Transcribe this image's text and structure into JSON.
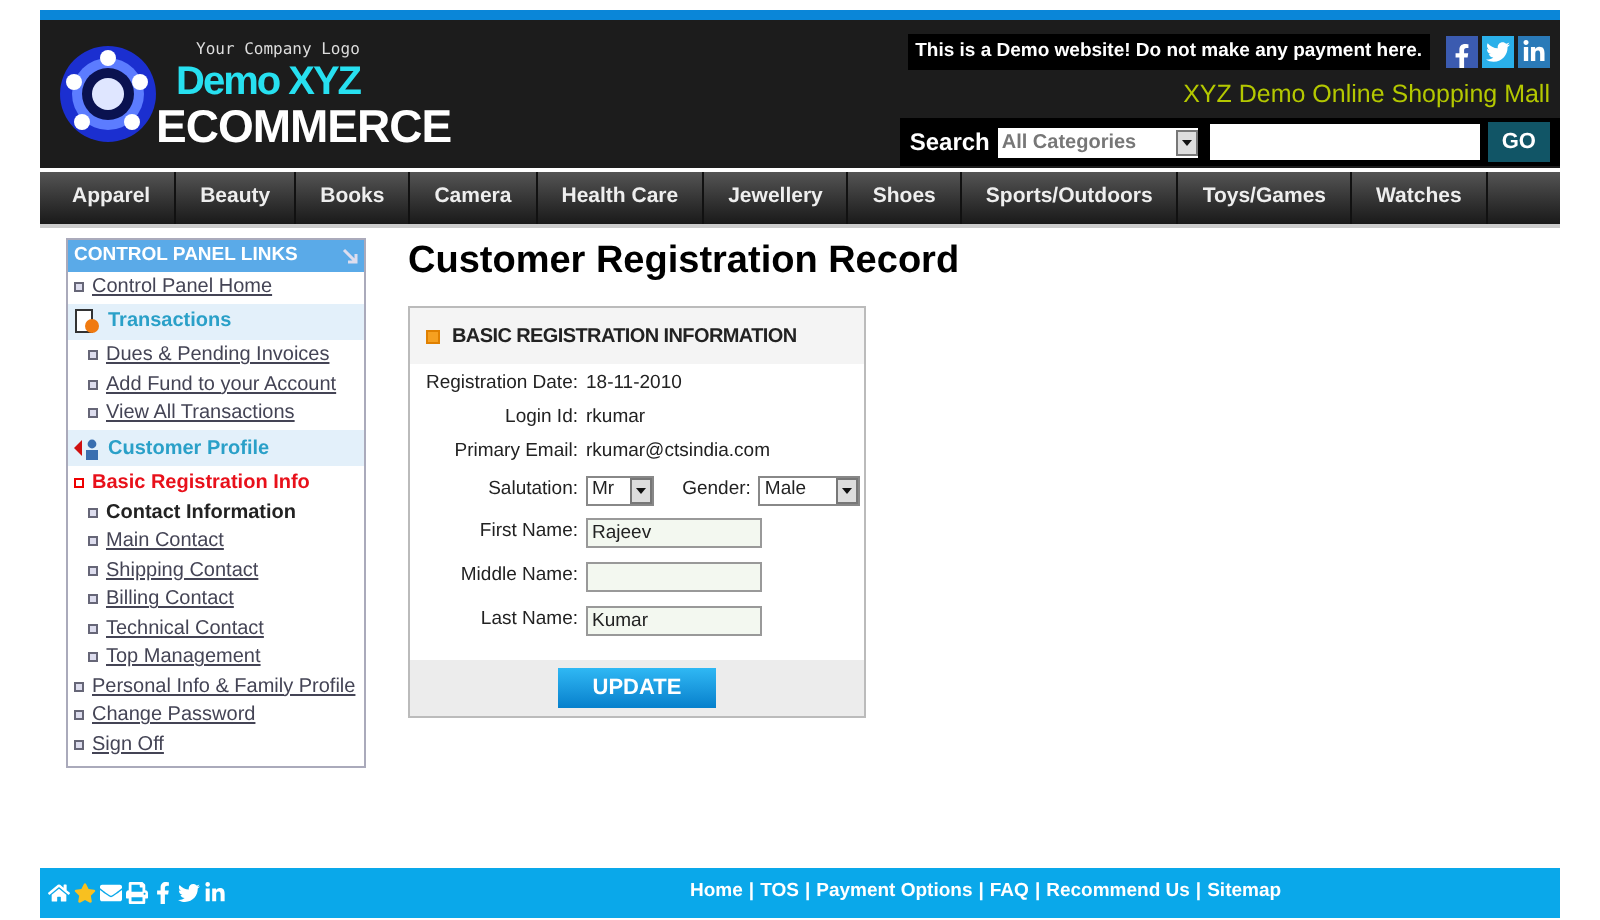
{
  "header": {
    "logo_caption": "Your Company Logo",
    "logo_line_1": "Demo XYZ",
    "logo_line_2": "ECOMMERCE",
    "notice": "This is a Demo website! Do not make any payment here.",
    "tagline": "XYZ Demo Online Shopping Mall",
    "search": {
      "label": "Search",
      "category": "All Categories",
      "button": "GO"
    }
  },
  "nav": [
    {
      "label": "Apparel"
    },
    {
      "label": "Beauty"
    },
    {
      "label": "Books"
    },
    {
      "label": "Camera"
    },
    {
      "label": "Health Care"
    },
    {
      "label": "Jewellery"
    },
    {
      "label": "Shoes"
    },
    {
      "label": "Sports/Outdoors"
    },
    {
      "label": "Toys/Games"
    },
    {
      "label": "Watches"
    }
  ],
  "sidebar": {
    "title": "CONTROL PANEL LINKS",
    "items": [
      {
        "kind": "link",
        "label": "Control Panel Home",
        "selected": false
      },
      {
        "kind": "section",
        "label": "Transactions",
        "children": [
          {
            "kind": "link",
            "label": "Dues & Pending Invoices",
            "selected": false
          },
          {
            "kind": "link",
            "label": "Add Fund to your Account",
            "selected": false
          },
          {
            "kind": "link",
            "label": "View All Transactions",
            "selected": false
          }
        ]
      },
      {
        "kind": "section",
        "label": "Customer Profile"
      },
      {
        "kind": "link",
        "label": "Basic Registration Info",
        "selected": true
      },
      {
        "kind": "group",
        "label": "Contact Information",
        "children": [
          {
            "kind": "link",
            "label": "Main Contact",
            "selected": false
          },
          {
            "kind": "link",
            "label": "Shipping Contact",
            "selected": false
          },
          {
            "kind": "link",
            "label": "Billing Contact",
            "selected": false
          },
          {
            "kind": "link",
            "label": "Technical Contact",
            "selected": false
          },
          {
            "kind": "link",
            "label": "Top Management",
            "selected": false
          }
        ]
      },
      {
        "kind": "link",
        "label": "Personal Info & Family Profile",
        "selected": false
      },
      {
        "kind": "link",
        "label": "Change Password",
        "selected": false
      },
      {
        "kind": "link",
        "label": "Sign Off",
        "selected": false
      }
    ]
  },
  "page_title": "Customer Registration Record",
  "form": {
    "title": "BASIC REGISTRATION INFORMATION",
    "rows": [
      {
        "kind": "text",
        "label": "Registration Date:",
        "value": "18-11-2010"
      },
      {
        "kind": "text",
        "label": "Login Id:",
        "value": "rkumar"
      },
      {
        "kind": "text",
        "label": "Primary Email:",
        "value": "rkumar@ctsindia.com"
      },
      {
        "kind": "selects",
        "label": "Salutation:",
        "value": "Mr",
        "label_2": "Gender:",
        "value_2": "Male"
      },
      {
        "kind": "input",
        "label": "First Name:",
        "value": "Rajeev"
      },
      {
        "kind": "input",
        "label": "Middle Name:"
      },
      {
        "kind": "input",
        "label": "Last Name:",
        "value": "Kumar"
      }
    ],
    "button": "UPDATE"
  },
  "footer": {
    "separator": "|",
    "links": [
      "Home",
      "TOS",
      "Payment Options",
      "FAQ",
      "Recommend Us",
      "Sitemap"
    ]
  }
}
